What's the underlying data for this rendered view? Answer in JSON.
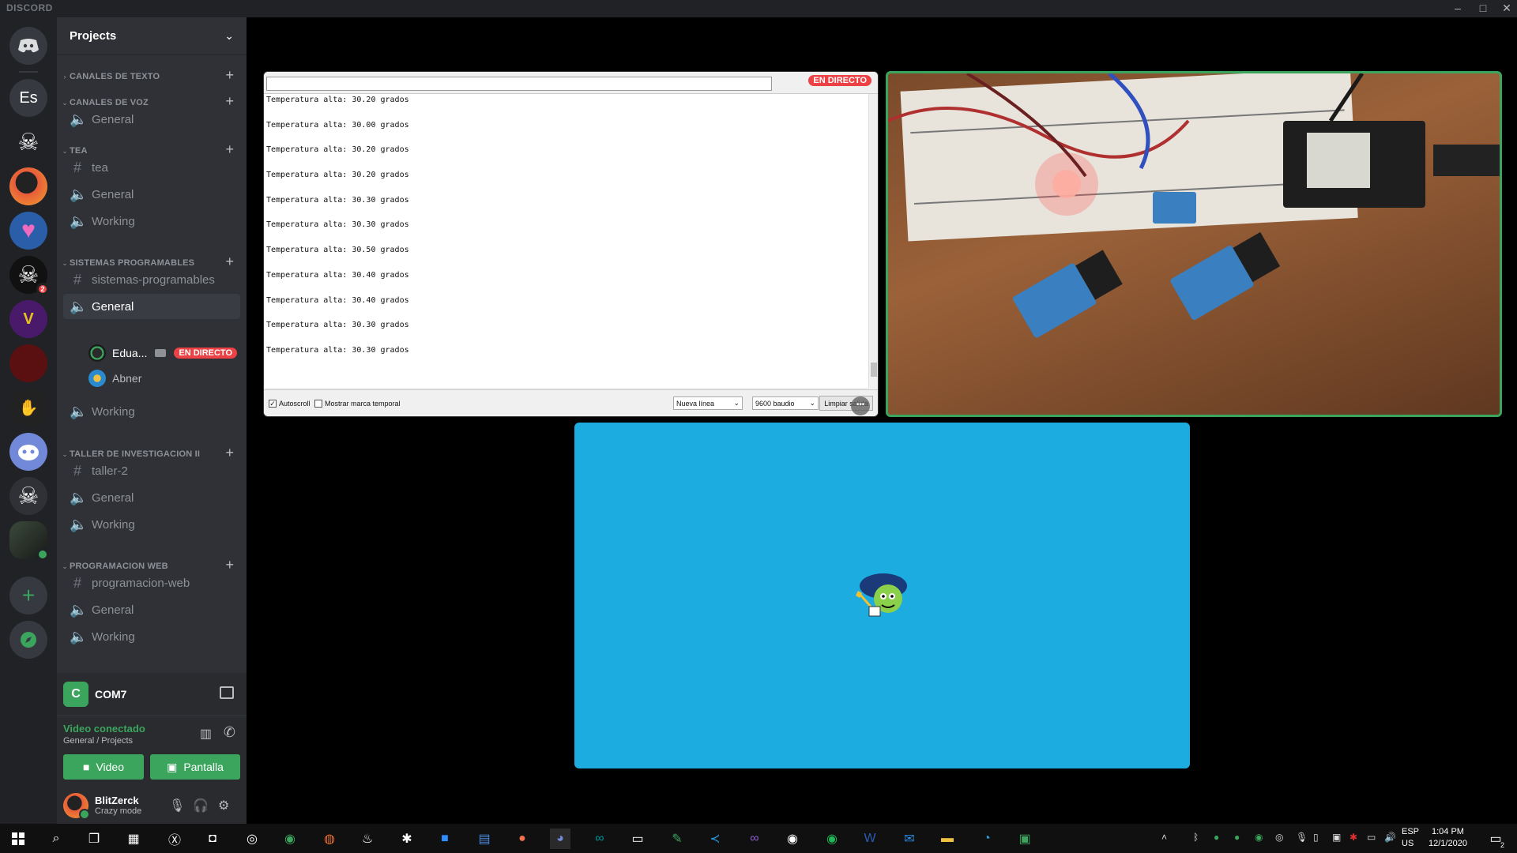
{
  "app": {
    "title": "DISCORD",
    "window_controls": [
      "–",
      "□",
      "✕"
    ]
  },
  "server_rail": {
    "home_icon": "discord-logo-icon",
    "servers": [
      {
        "name": "Es",
        "label": "Es",
        "badge": ""
      },
      {
        "name": "skull-server",
        "label": "☠",
        "badge": ""
      },
      {
        "name": "red-avatar-server",
        "label": "",
        "badge": ""
      },
      {
        "name": "heart-gaming-server",
        "label": "♥",
        "badge": ""
      },
      {
        "name": "skull-server-2",
        "label": "☠",
        "badge": "2"
      },
      {
        "name": "v-server",
        "label": "V",
        "badge": ""
      },
      {
        "name": "red-logo-server",
        "label": "",
        "badge": ""
      },
      {
        "name": "hand-server",
        "label": "✋",
        "badge": ""
      },
      {
        "name": "discord-mascot-server",
        "label": "",
        "badge": ""
      },
      {
        "name": "pirate-server",
        "label": "☠",
        "badge": ""
      },
      {
        "name": "projects-server",
        "label": "",
        "badge": ""
      }
    ],
    "add_server": "+",
    "explore": "explore-icon"
  },
  "guild": {
    "name": "Projects",
    "categories": [
      {
        "label": "CANALES DE TEXTO",
        "channels": []
      },
      {
        "label": "CANALES DE VOZ",
        "channels": [
          {
            "type": "voice",
            "label": "General"
          }
        ]
      },
      {
        "label": "TEA",
        "channels": [
          {
            "type": "text",
            "label": "tea"
          },
          {
            "type": "voice",
            "label": "General"
          },
          {
            "type": "voice",
            "label": "Working"
          }
        ]
      },
      {
        "label": "SISTEMAS PROGRAMABLES",
        "channels": [
          {
            "type": "text",
            "label": "sistemas-programables"
          },
          {
            "type": "voice",
            "label": "General"
          },
          {
            "type": "voice",
            "label": "Working"
          }
        ]
      },
      {
        "label": "TALLER DE INVESTIGACION II",
        "channels": [
          {
            "type": "text",
            "label": "taller-2"
          },
          {
            "type": "voice",
            "label": "General"
          },
          {
            "type": "voice",
            "label": "Working"
          }
        ]
      },
      {
        "label": "PROGRAMACION WEB",
        "channels": [
          {
            "type": "text",
            "label": "programacion-web"
          },
          {
            "type": "voice",
            "label": "General"
          },
          {
            "type": "voice",
            "label": "Working"
          }
        ]
      }
    ],
    "voice_users": [
      {
        "name": "Edua...",
        "live": "EN DIRECTO"
      },
      {
        "name": "Abner"
      }
    ]
  },
  "stream_panel": {
    "icon_letter": "C",
    "name": "COM7"
  },
  "voice_panel": {
    "status": "Video conectado",
    "location": "General / Projects",
    "video_label": "Video",
    "screen_label": "Pantalla"
  },
  "user_panel": {
    "username": "BlitZerck",
    "status": "Crazy mode"
  },
  "serial_monitor": {
    "live_label": "EN DIRECTO",
    "lines": [
      "Temperatura alta: 30.20 grados",
      "Temperatura alta: 30.00 grados",
      "Temperatura alta: 30.20 grados",
      "Temperatura alta: 30.20 grados",
      "Temperatura alta: 30.30 grados",
      "Temperatura alta: 30.30 grados",
      "Temperatura alta: 30.50 grados",
      "Temperatura alta: 30.40 grados",
      "Temperatura alta: 30.40 grados",
      "Temperatura alta: 30.30 grados",
      "Temperatura alta: 30.30 grados"
    ],
    "autoscroll": "Autoscroll",
    "timestamp": "Mostrar marca temporal",
    "line_ending": "Nueva línea",
    "baud": "9600 baudio",
    "clear": "Limpiar salida"
  },
  "taskbar": {
    "lang": "ESP",
    "region": "US",
    "time": "1:04 PM",
    "date": "12/1/2020",
    "notif_badge": "2"
  },
  "colors": {
    "accent_green": "#3ba55d",
    "live_red": "#ed4245",
    "avatar_bg": "#1cace0"
  }
}
